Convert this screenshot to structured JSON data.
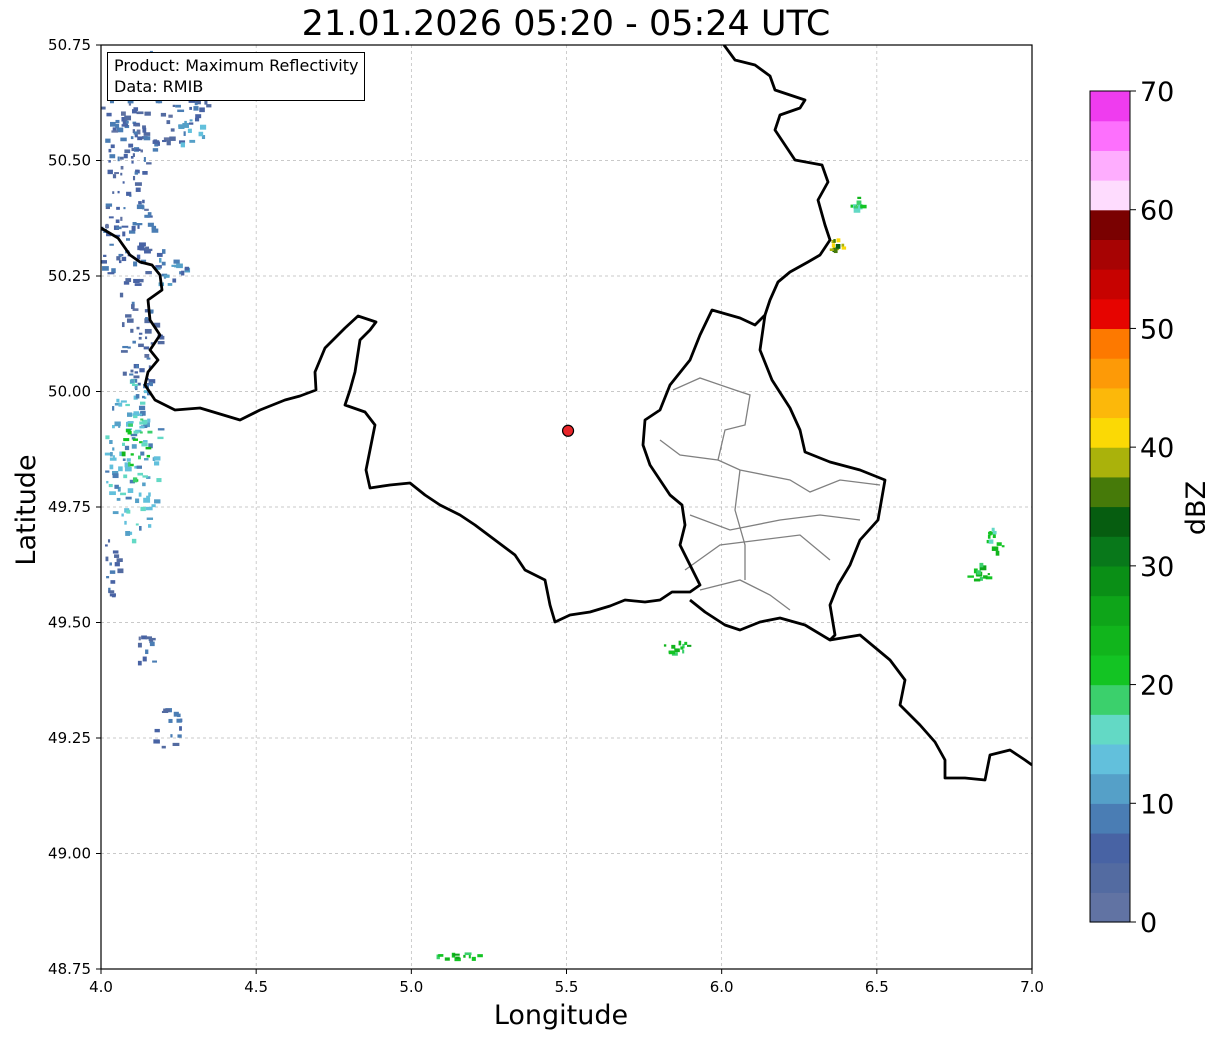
{
  "title": "21.01.2026 05:20 - 05:24 UTC",
  "info_box": {
    "product": "Product: Maximum Reflectivity",
    "source": "Data: RMIB"
  },
  "axes": {
    "xlabel": "Longitude",
    "ylabel": "Latitude",
    "xlim": [
      4.0,
      7.0
    ],
    "ylim": [
      48.75,
      50.75
    ],
    "xticks": [
      "4.0",
      "4.5",
      "5.0",
      "5.5",
      "6.0",
      "6.5",
      "7.0"
    ],
    "yticks": [
      "50.75",
      "50.50",
      "50.25",
      "50.00",
      "49.75",
      "49.50",
      "49.25",
      "49.00",
      "48.75"
    ],
    "grid": true
  },
  "radar_site": {
    "lon": 5.505,
    "lat": 49.915,
    "color": "#e8262a"
  },
  "colorbar": {
    "label": "dBZ",
    "range": [
      0,
      70
    ],
    "ticks": [
      "0",
      "10",
      "20",
      "30",
      "40",
      "50",
      "60",
      "70"
    ],
    "colors": [
      "#6173a3",
      "#536ba1",
      "#4863a4",
      "#4a7db4",
      "#55a0c8",
      "#62c0dc",
      "#63d9c5",
      "#3bd06c",
      "#13c423",
      "#11b51c",
      "#0ea519",
      "#0a8f16",
      "#08781a",
      "#065d10",
      "#467a09",
      "#aab20b",
      "#fbd905",
      "#fcb80a",
      "#fd9a07",
      "#fd7900",
      "#e60400",
      "#c70200",
      "#a70303",
      "#7a0101",
      "#fedcfe",
      "#feadfe",
      "#fd70fd",
      "#ef3cef"
    ]
  },
  "echoes": [
    {
      "lon": 4.17,
      "lat": 50.63,
      "rx": 0.17,
      "ry": 0.11,
      "dbz": 6
    },
    {
      "lon": 4.28,
      "lat": 50.56,
      "rx": 0.05,
      "ry": 0.03,
      "dbz": 15
    },
    {
      "lon": 4.08,
      "lat": 50.52,
      "rx": 0.08,
      "ry": 0.08,
      "dbz": 6
    },
    {
      "lon": 4.08,
      "lat": 50.33,
      "rx": 0.09,
      "ry": 0.12,
      "dbz": 6
    },
    {
      "lon": 4.22,
      "lat": 50.27,
      "rx": 0.05,
      "ry": 0.06,
      "dbz": 9
    },
    {
      "lon": 4.12,
      "lat": 50.1,
      "rx": 0.07,
      "ry": 0.1,
      "dbz": 6
    },
    {
      "lon": 4.1,
      "lat": 49.86,
      "rx": 0.09,
      "ry": 0.18,
      "dbz": 12
    },
    {
      "lon": 4.11,
      "lat": 49.87,
      "rx": 0.05,
      "ry": 0.08,
      "dbz": 20
    },
    {
      "lon": 4.03,
      "lat": 49.63,
      "rx": 0.03,
      "ry": 0.08,
      "dbz": 6
    },
    {
      "lon": 4.21,
      "lat": 49.27,
      "rx": 0.05,
      "ry": 0.05,
      "dbz": 6
    },
    {
      "lon": 4.14,
      "lat": 49.44,
      "rx": 0.03,
      "ry": 0.04,
      "dbz": 6
    },
    {
      "lon": 6.37,
      "lat": 50.32,
      "rx": 0.03,
      "ry": 0.015,
      "dbz": 38
    },
    {
      "lon": 6.43,
      "lat": 50.41,
      "rx": 0.02,
      "ry": 0.02,
      "dbz": 20
    },
    {
      "lon": 6.88,
      "lat": 49.68,
      "rx": 0.03,
      "ry": 0.03,
      "dbz": 20
    },
    {
      "lon": 6.82,
      "lat": 49.61,
      "rx": 0.04,
      "ry": 0.02,
      "dbz": 22
    },
    {
      "lon": 5.85,
      "lat": 49.45,
      "rx": 0.04,
      "ry": 0.015,
      "dbz": 22
    },
    {
      "lon": 5.15,
      "lat": 48.78,
      "rx": 0.08,
      "ry": 0.008,
      "dbz": 22
    }
  ]
}
